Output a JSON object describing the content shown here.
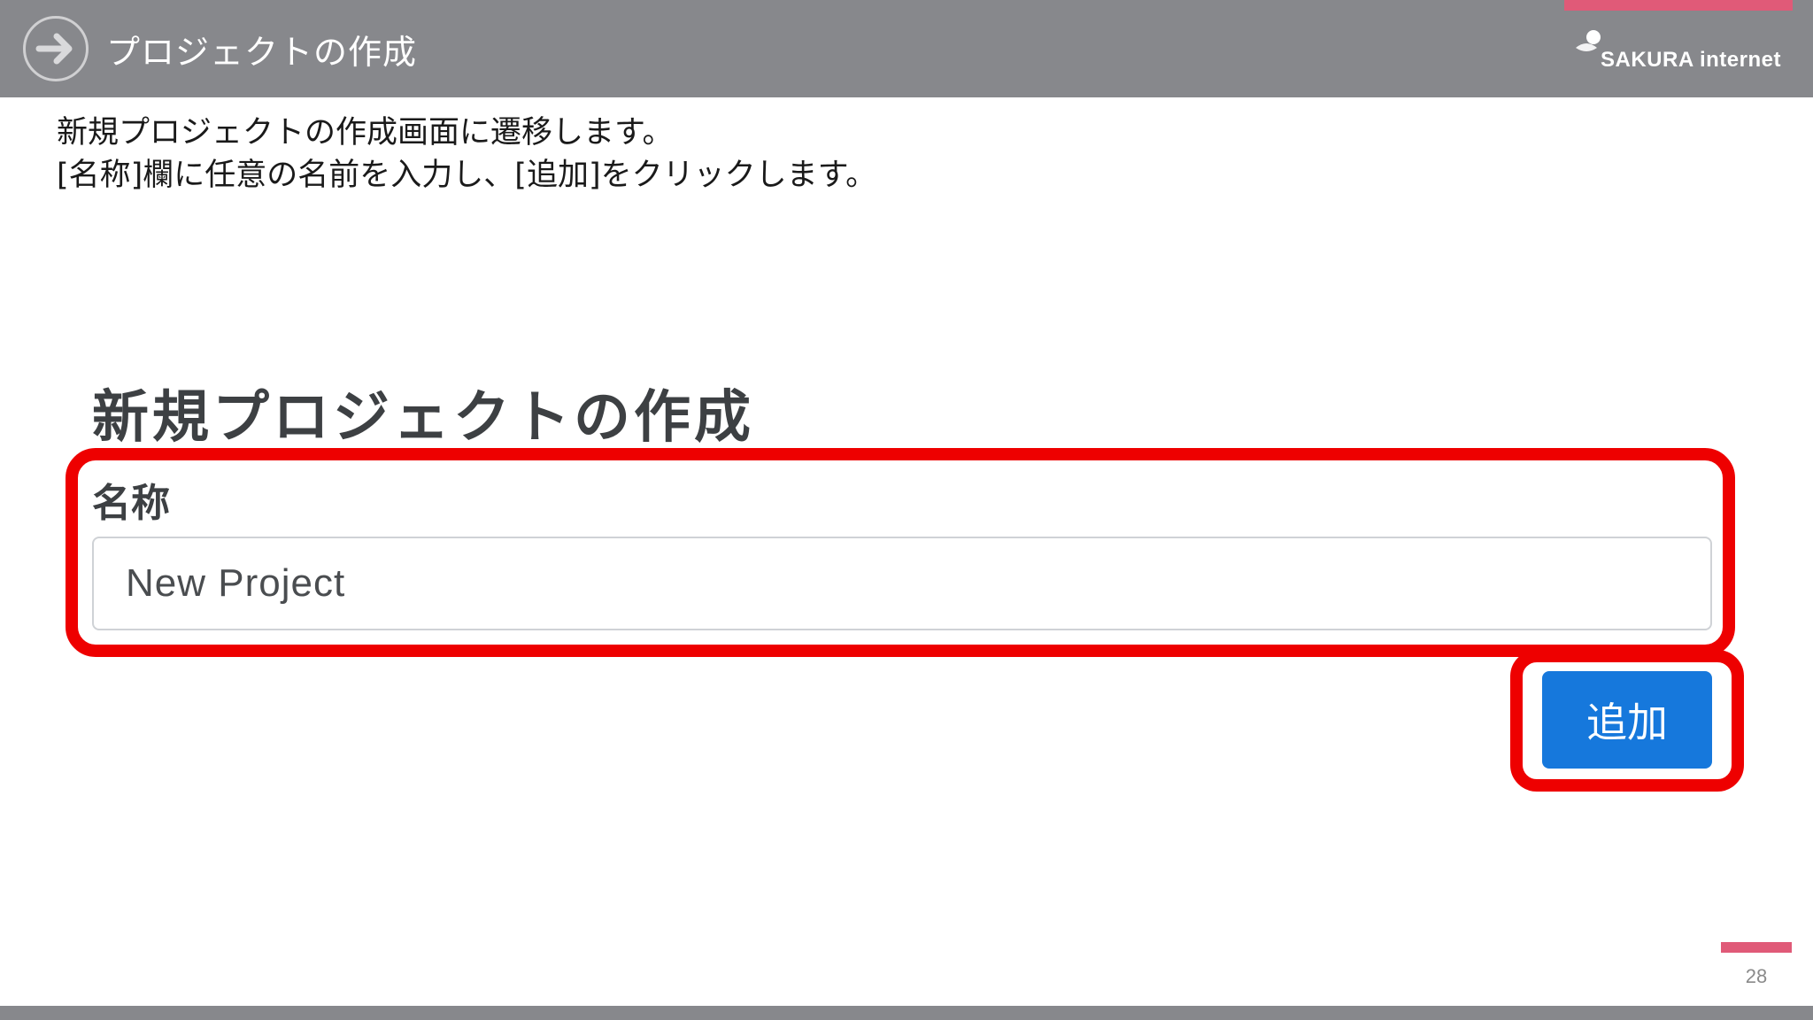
{
  "header": {
    "title": "プロジェクトの作成",
    "logo_text": "SAKURA internet",
    "accent_color": "#e05a78",
    "background_color": "#87888c",
    "icon": "arrow-right-circle-icon"
  },
  "instructions": {
    "line1": "新規プロジェクトの作成画面に遷移します。",
    "line2": "[名称]欄に任意の名前を入力し、[追加]をクリックします。"
  },
  "form": {
    "title": "新規プロジェクトの作成",
    "name_label": "名称",
    "name_value": "New Project",
    "add_button_label": "追加",
    "button_color": "#1678dc",
    "highlight_color": "#ee0000"
  },
  "footer": {
    "page_number": "28"
  }
}
